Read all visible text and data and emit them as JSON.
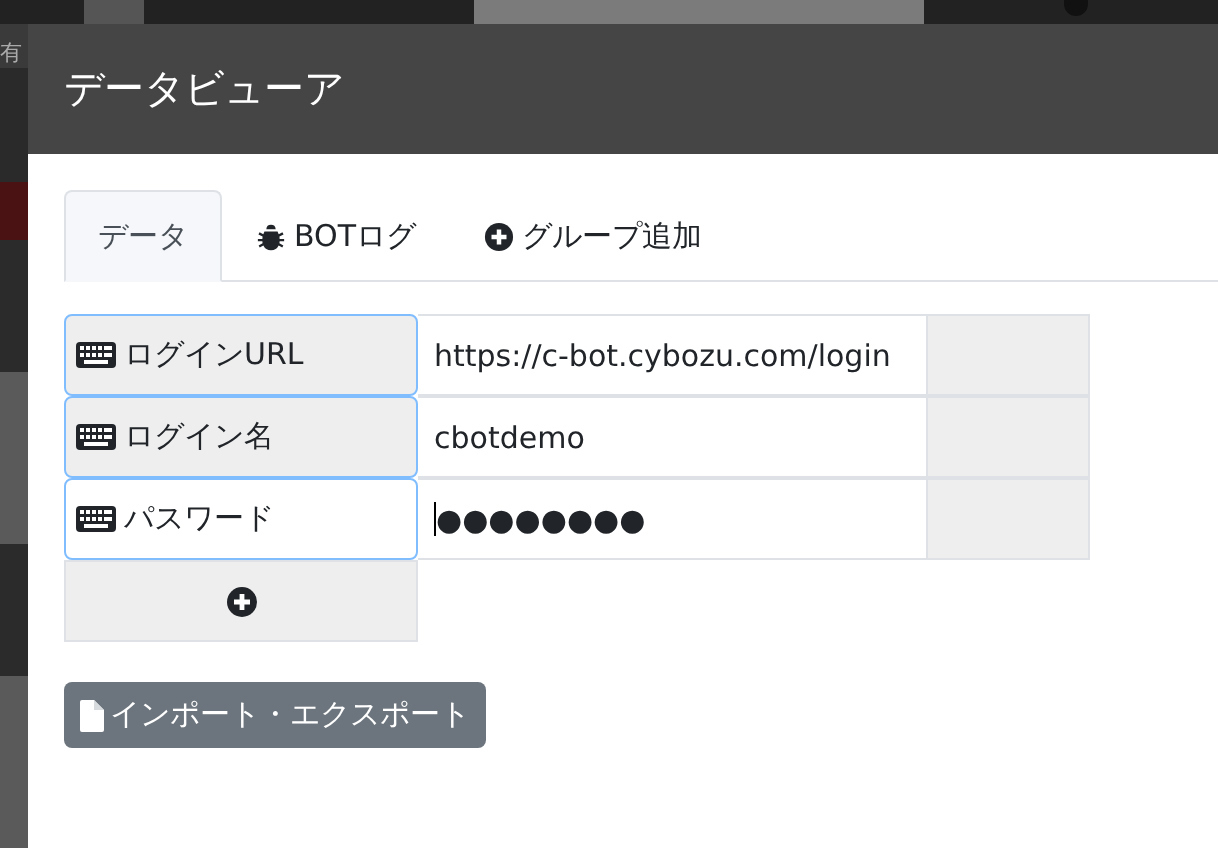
{
  "background": {
    "left_label": "有"
  },
  "dialog": {
    "title": "データビューア"
  },
  "tabs": [
    {
      "label": "データ",
      "kind": "plain",
      "selected": true
    },
    {
      "label": "BOTログ",
      "kind": "bug",
      "selected": false
    },
    {
      "label": "グループ追加",
      "kind": "plus",
      "selected": false
    }
  ],
  "rows": [
    {
      "label": "ログインURL",
      "value": "https://c-bot.cybozu.com/login",
      "focused": false
    },
    {
      "label": "ログイン名",
      "value": "cbotdemo",
      "focused": false
    },
    {
      "label": "パスワード",
      "value": "●●●●●●●●",
      "focused": true
    }
  ],
  "button": {
    "label": "インポート・エクスポート"
  }
}
